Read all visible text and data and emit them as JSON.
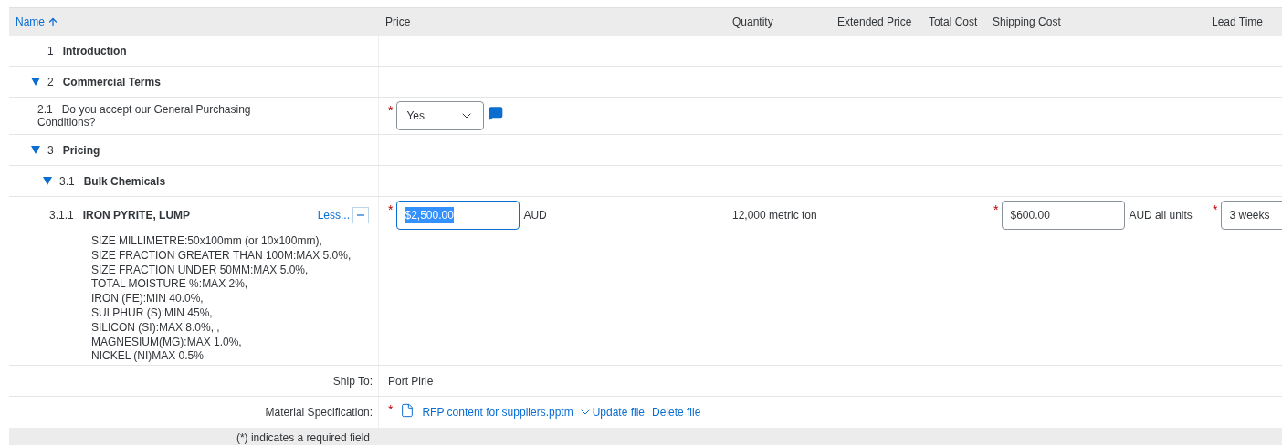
{
  "columns": [
    {
      "label": "Name",
      "sorted": true
    },
    {
      "label": "Price",
      "sorted": false
    },
    {
      "label": "Quantity",
      "sorted": false
    },
    {
      "label": "Extended Price",
      "sorted": false
    },
    {
      "label": "Total Cost",
      "sorted": false
    },
    {
      "label": "Shipping Cost",
      "sorted": false
    },
    {
      "label": "Lead Time",
      "sorted": false
    }
  ],
  "rows": [
    {
      "kind": "section",
      "number": "1",
      "title": "Introduction"
    },
    {
      "kind": "section",
      "number": "2",
      "title": "Commercial Terms",
      "expanded": true,
      "children": [
        {
          "kind": "question",
          "number": "2.1",
          "title": "Do you accept our General Purchasing Conditions?",
          "answer": {
            "value": "Yes",
            "required": true
          }
        }
      ]
    },
    {
      "kind": "section",
      "number": "3",
      "title": "Pricing",
      "expanded": true,
      "children": [
        {
          "kind": "section",
          "number": "3.1",
          "title": "Bulk Chemicals",
          "expanded": true,
          "children": [
            {
              "kind": "item",
              "number": "3.1.1",
              "title": "IRON PYRITE, LUMP",
              "toggle": "Less...",
              "price": {
                "value": "$2,500.00",
                "required": true,
                "focused": true
              },
              "currency": "AUD",
              "quantity": "12,000 metric ton",
              "shipping": {
                "value": "$600.00",
                "required": true,
                "focused": false
              },
              "shipping_unit": "AUD all units",
              "lead_time": {
                "value": "3 weeks",
                "required": true,
                "focused": false
              },
              "description": [
                "SIZE MILLIMETRE:50x100mm (or 10x100mm),",
                "SIZE FRACTION GREATER THAN 100M:MAX 5.0%,",
                "SIZE FRACTION UNDER 50MM:MAX 5.0%,",
                "TOTAL MOISTURE %:MAX 2%,",
                "IRON (FE):MIN 40.0%,",
                "SULPHUR (S):MIN 45%,",
                "SILICON (SI):MAX 8.0%, ,",
                "MAGNESIUM(MG):MAX 1.0%,",
                "NICKEL (NI)MAX 0.5%"
              ],
              "ship_to": {
                "label": "Ship To:",
                "value": "Port Pirie"
              },
              "material": {
                "label": "Material Specification:",
                "required": true,
                "file": "RFP content for suppliers.pptm",
                "update": "Update file",
                "delete": "Delete file"
              }
            }
          ]
        }
      ]
    }
  ],
  "footer": "(*) indicates a required field",
  "required_mark": "*"
}
